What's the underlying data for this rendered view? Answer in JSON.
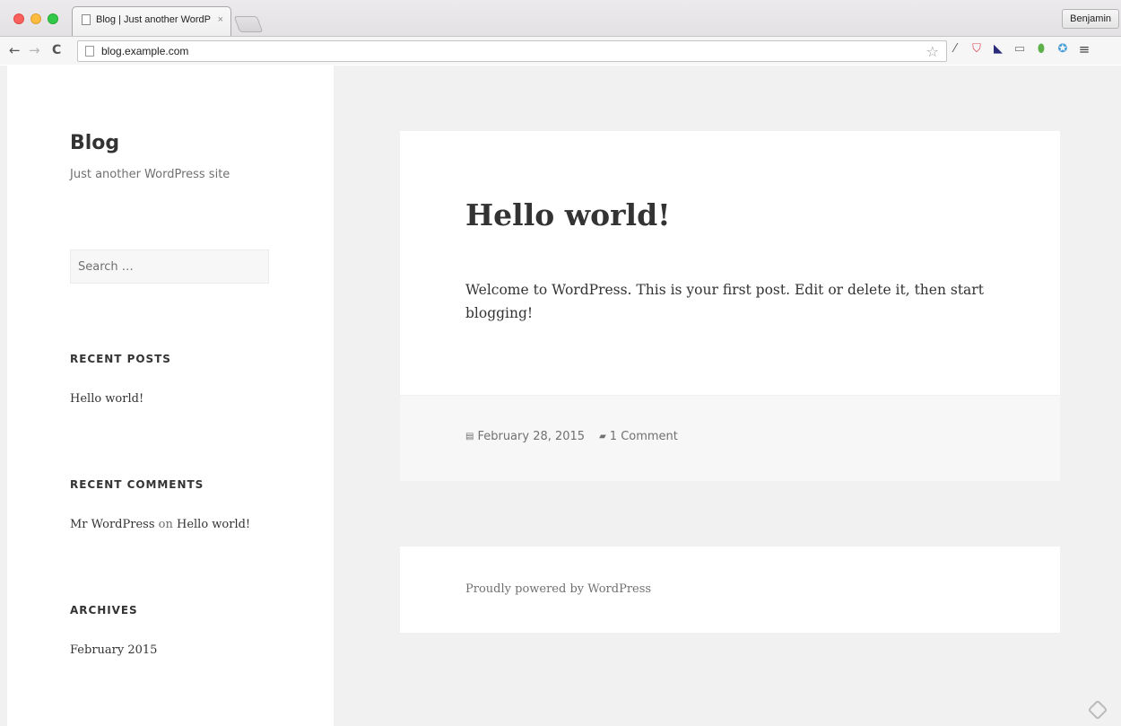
{
  "browser": {
    "tab_title": "Blog | Just another WordP",
    "tab_close": "×",
    "profile_name": "Benjamin",
    "url": "blog.example.com",
    "nav": {
      "back": "←",
      "forward": "→",
      "reload": "C"
    },
    "star": "☆",
    "extensions": {
      "dropper": "⁄",
      "pocket": "⛉",
      "dark": "◣",
      "cast": "▭",
      "evernote": "⬮",
      "blue": "✪",
      "menu": "≡"
    }
  },
  "sidebar": {
    "site_title": "Blog",
    "site_description": "Just another WordPress site",
    "search_placeholder": "Search …",
    "recent_posts": {
      "title": "RECENT POSTS",
      "items": [
        "Hello world!"
      ]
    },
    "recent_comments": {
      "title": "RECENT COMMENTS",
      "author": "Mr WordPress",
      "on": "on",
      "post": "Hello world!"
    },
    "archives": {
      "title": "ARCHIVES",
      "items": [
        "February 2015"
      ]
    }
  },
  "post": {
    "title": "Hello world!",
    "content": "Welcome to WordPress. This is your first post. Edit or delete it, then start blogging!",
    "date_icon": "▤",
    "date": "February 28, 2015",
    "comments_icon": "▰",
    "comments": "1 Comment"
  },
  "footer": {
    "powered_by": "Proudly powered by WordPress"
  }
}
